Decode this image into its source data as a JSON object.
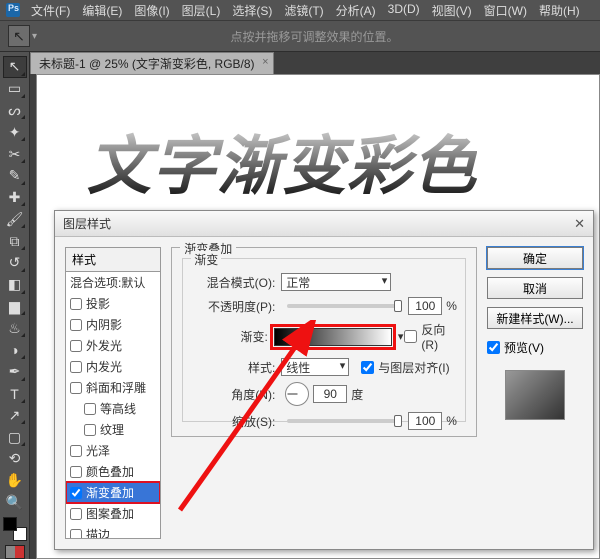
{
  "menus": [
    "文件(F)",
    "编辑(E)",
    "图像(I)",
    "图层(L)",
    "选择(S)",
    "滤镜(T)",
    "分析(A)",
    "3D(D)",
    "视图(V)",
    "窗口(W)",
    "帮助(H)"
  ],
  "options_hint": "点按并拖移可调整效果的位置。",
  "doc_tab": "未标题-1 @ 25% (文字渐变彩色, RGB/8)",
  "canvas_text": "文字渐变彩色",
  "dialog": {
    "title": "图层样式",
    "styles_header": "样式",
    "blend_header": "混合选项:默认",
    "effects": [
      {
        "label": "投影",
        "checked": false
      },
      {
        "label": "内阴影",
        "checked": false
      },
      {
        "label": "外发光",
        "checked": false
      },
      {
        "label": "内发光",
        "checked": false
      },
      {
        "label": "斜面和浮雕",
        "checked": false
      },
      {
        "label": "等高线",
        "checked": false,
        "indent": true
      },
      {
        "label": "纹理",
        "checked": false,
        "indent": true
      },
      {
        "label": "光泽",
        "checked": false
      },
      {
        "label": "颜色叠加",
        "checked": false
      },
      {
        "label": "渐变叠加",
        "checked": true,
        "hl": true
      },
      {
        "label": "图案叠加",
        "checked": false
      },
      {
        "label": "描边",
        "checked": false
      }
    ],
    "group_title": "渐变叠加",
    "inner_title": "渐变",
    "blend_mode_label": "混合模式(O):",
    "blend_mode": "正常",
    "opacity_label": "不透明度(P):",
    "opacity": "100",
    "grad_label": "渐变:",
    "reverse": "反向(R)",
    "style_label": "样式:",
    "style": "线性",
    "align": "与图层对齐(I)",
    "angle_label": "角度(N):",
    "angle": "90",
    "angle_unit": "度",
    "scale_label": "缩放(S):",
    "scale": "100",
    "pct": "%",
    "ok": "确定",
    "cancel": "取消",
    "new_style": "新建样式(W)...",
    "preview": "预览(V)"
  }
}
